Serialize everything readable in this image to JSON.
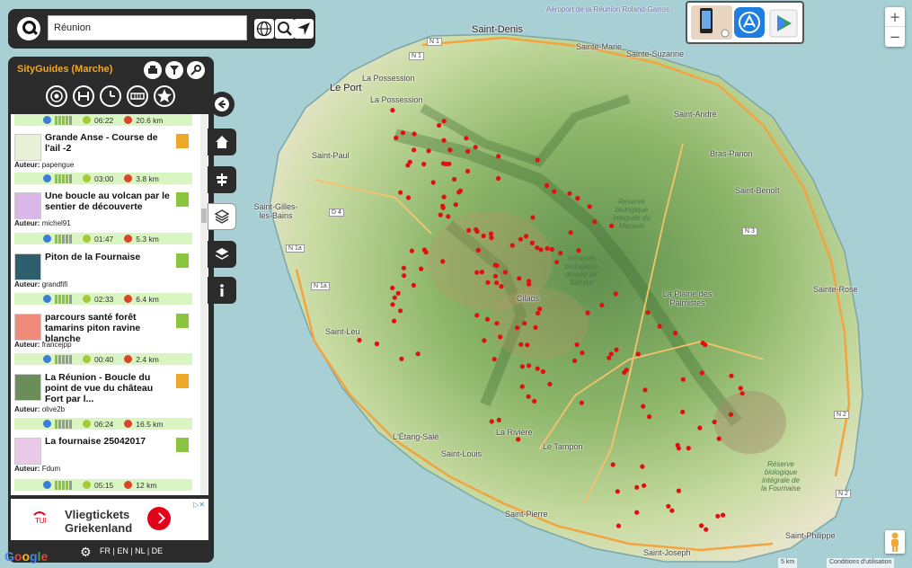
{
  "search": {
    "value": "Réunion"
  },
  "panel": {
    "title": "SityGuides (Marche)",
    "routes": [
      {
        "title": "",
        "author": "",
        "time": "06:22",
        "distance": "20.6 km",
        "difficulty": 4
      },
      {
        "title": "Grande Anse - Course de l'ail -2",
        "author": "papengue",
        "time": "03:00",
        "distance": "3.8 km",
        "difficulty": 4,
        "category": "orange"
      },
      {
        "title": "Une boucle au volcan par le sentier de découverte",
        "author": "michel91",
        "time": "01:47",
        "distance": "5.3 km",
        "difficulty": 2,
        "category": "green"
      },
      {
        "title": "Piton de la Fournaise",
        "author": "grandfifi",
        "time": "02:33",
        "distance": "6.4 km",
        "difficulty": 4,
        "category": "green"
      },
      {
        "title": "parcours santé forêt tamarins piton ravine blanche",
        "author": "francejpp",
        "time": "00:40",
        "distance": "2.4 km",
        "difficulty": 1,
        "category": "green"
      },
      {
        "title": "La Réunion - Boucle du point de vue du château Fort par l...",
        "author": "olive2b",
        "time": "06:24",
        "distance": "16.5 km",
        "difficulty": 1,
        "category": "orange"
      },
      {
        "title": "La fournaise 25042017",
        "author": "Fdum",
        "time": "05:15",
        "distance": "12 km",
        "difficulty": 4,
        "category": "green"
      }
    ],
    "author_label": "Auteur:",
    "languages": "FR | EN | NL | DE"
  },
  "ad": {
    "line1": "Vliegtickets",
    "line2": "Griekenland",
    "tag": "▷✕",
    "logo_text": "TUI"
  },
  "map": {
    "places": [
      {
        "name": "Saint-Denis",
        "cls": "big"
      },
      {
        "name": "Sainte-Marie"
      },
      {
        "name": "Sainte-Suzanne"
      },
      {
        "name": "Le Port",
        "cls": "big"
      },
      {
        "name": "La Possession"
      },
      {
        "name": "La Possession"
      },
      {
        "name": "Saint-André"
      },
      {
        "name": "Bras-Panon"
      },
      {
        "name": "Saint-Benoît"
      },
      {
        "name": "Saint-Paul"
      },
      {
        "name": "Saint-Gilles-les-Bains"
      },
      {
        "name": "Sainte-Rose"
      },
      {
        "name": "La Plaine des Palmistes"
      },
      {
        "name": "Saint-Leu"
      },
      {
        "name": "L'Étang-Salé"
      },
      {
        "name": "La Rivière"
      },
      {
        "name": "Saint-Louis"
      },
      {
        "name": "Le Tampon"
      },
      {
        "name": "Saint-Pierre"
      },
      {
        "name": "Saint-Joseph"
      },
      {
        "name": "Saint-Philippe"
      },
      {
        "name": "Cilaos"
      }
    ],
    "roads": [
      "N 1",
      "N 1",
      "N 1a",
      "N 1a",
      "D 4",
      "N 3",
      "N 2",
      "N 2"
    ],
    "reserves": [
      "Réserve biologique intégrale du Mazerin",
      "Réserve biologique dirigée de Bébour",
      "Réserve biologique intégrale de la Fournaise"
    ],
    "airport": "Aéroport de la Réunion Roland-Garros",
    "scale": "5 km",
    "attribution": "Conditions d'utilisation",
    "google": [
      "G",
      "o",
      "o",
      "g",
      "l",
      "e"
    ]
  },
  "colors": {
    "panel_bg": "#2b2b2b",
    "accent": "#f0a82a",
    "sea": "#a8cfd4",
    "pin": "#e01010",
    "stats_bg": "#d9f5c2"
  }
}
